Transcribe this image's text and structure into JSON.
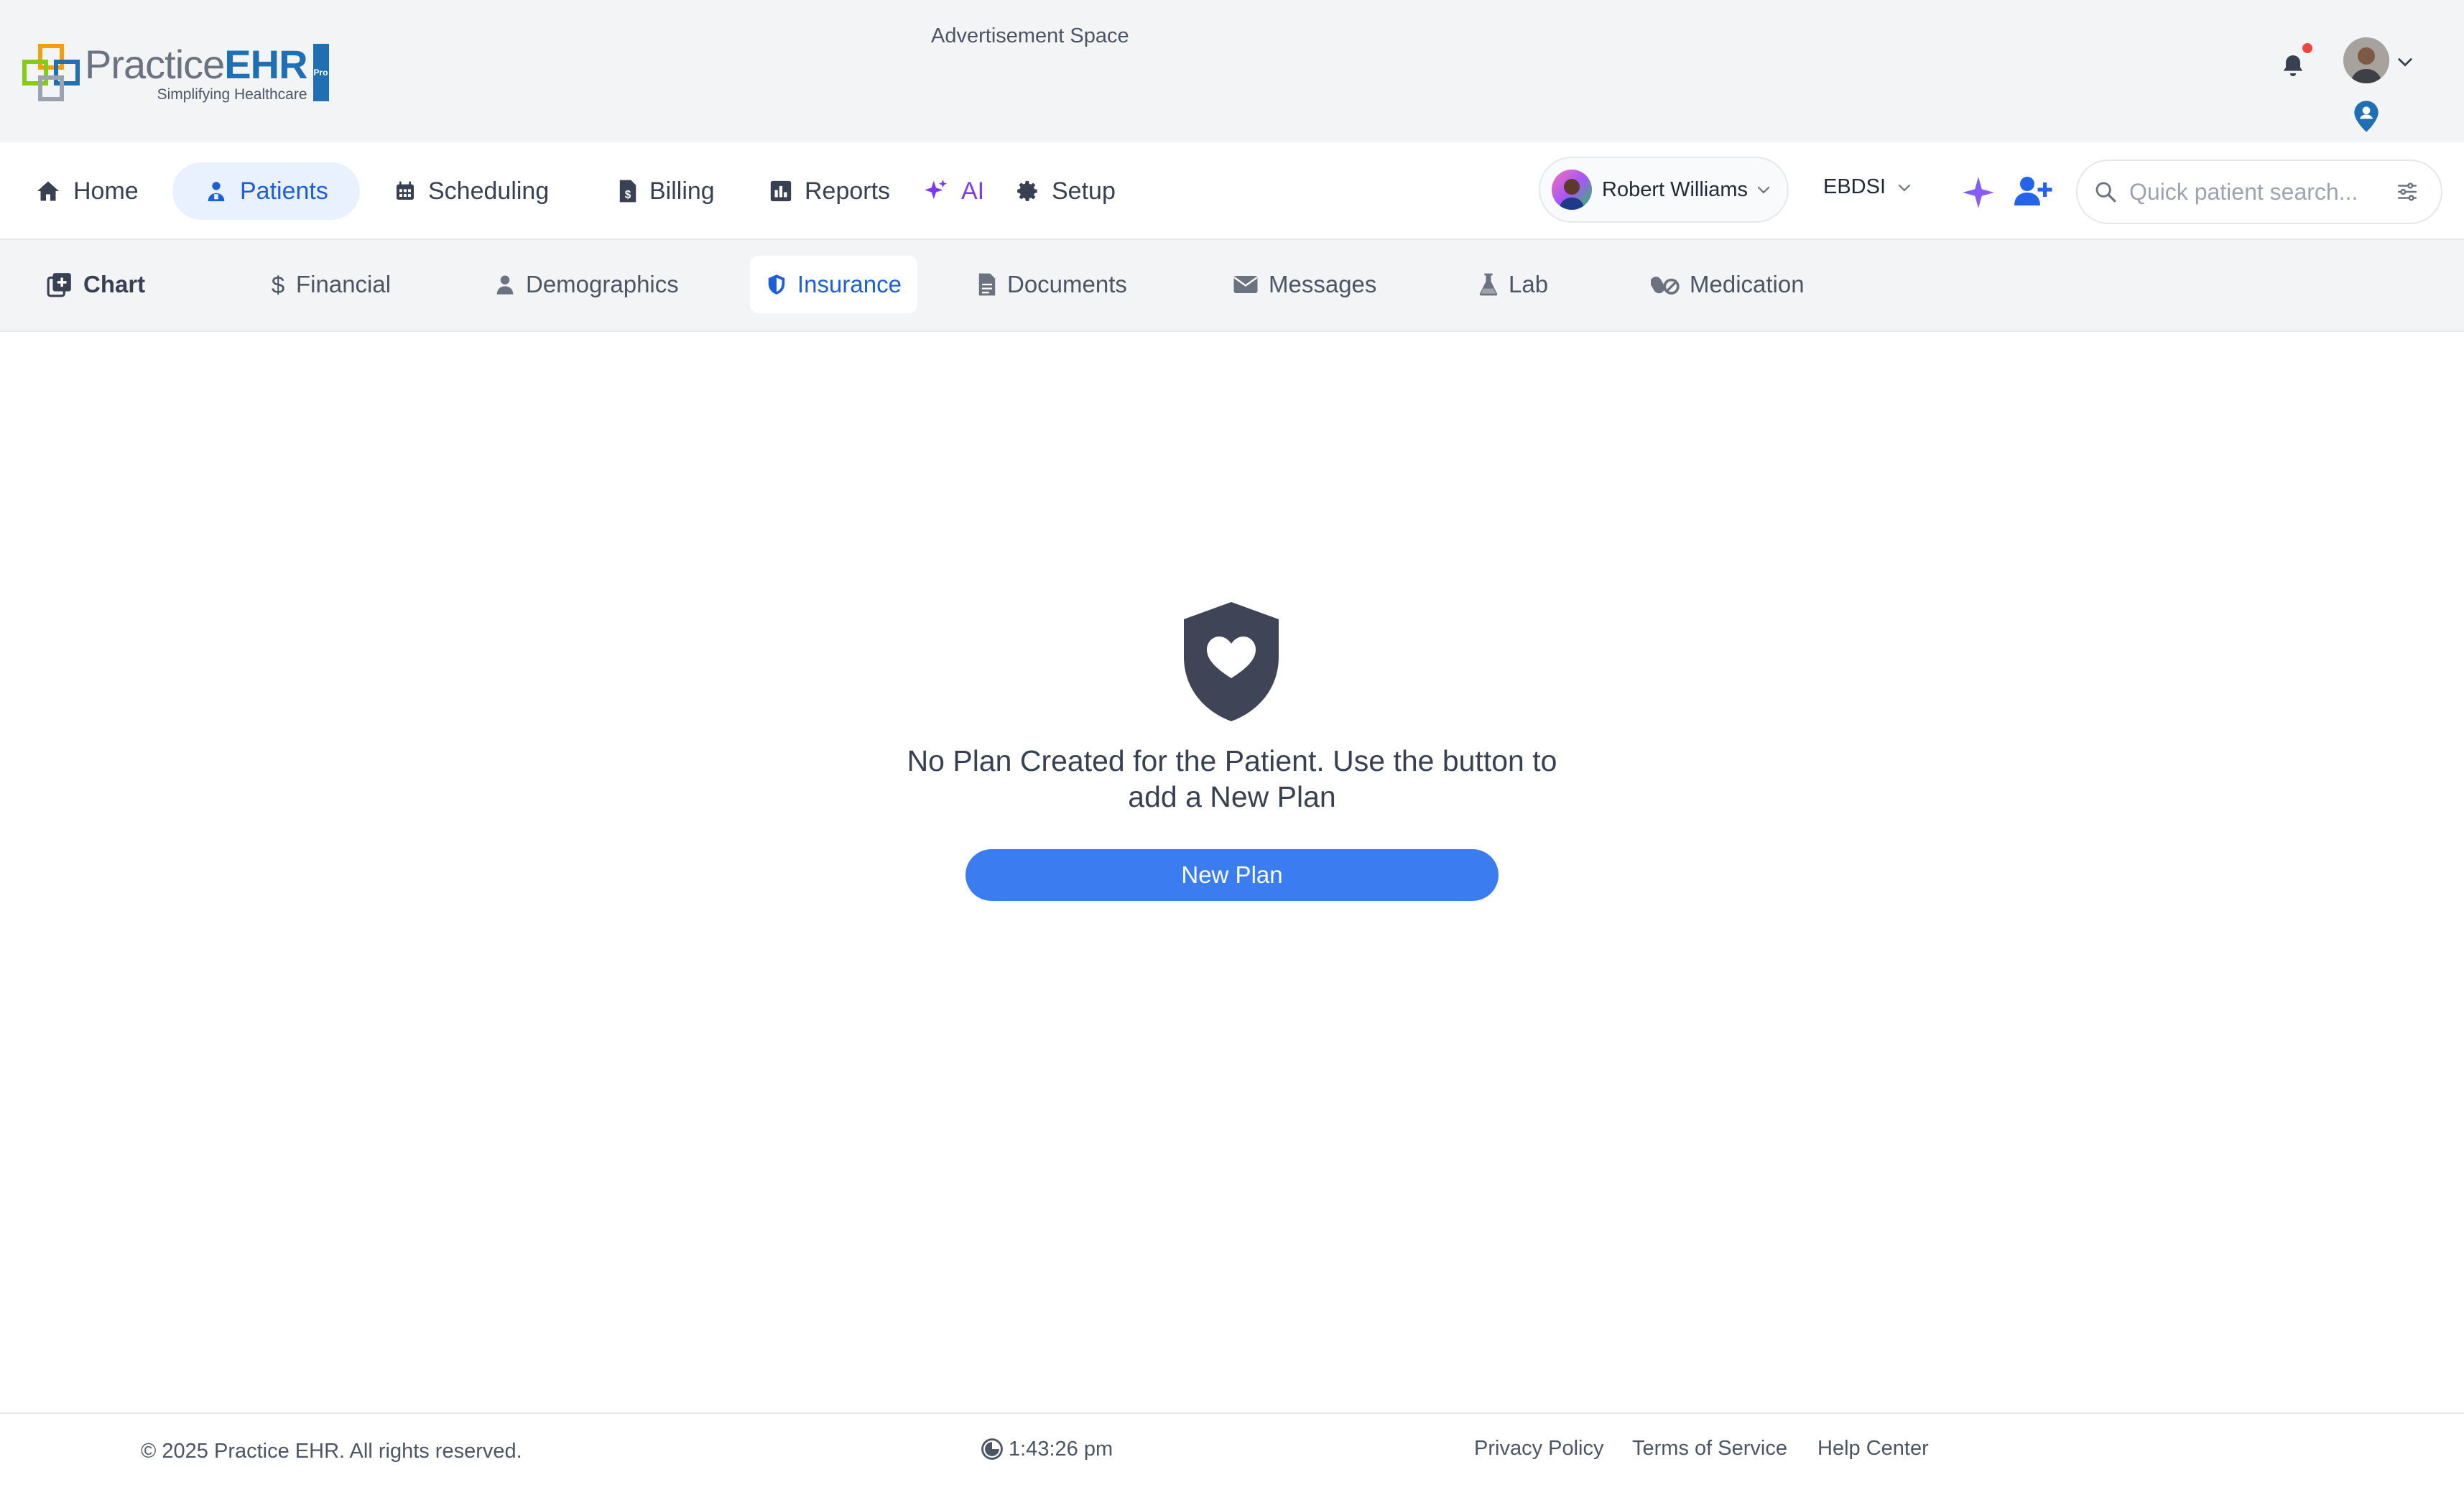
{
  "brand": {
    "name_part1": "Practice",
    "name_part2": "EHR",
    "tagline": "Simplifying Healthcare",
    "badge": "Pro"
  },
  "ad": {
    "label": "Advertisement Space"
  },
  "header": {
    "notification_dot_color": "#ef4444"
  },
  "nav": {
    "home": "Home",
    "patients": "Patients",
    "scheduling": "Scheduling",
    "billing": "Billing",
    "reports": "Reports",
    "ai": "AI",
    "setup": "Setup"
  },
  "patient_selector": {
    "name": "Robert Williams"
  },
  "facility": {
    "name": "EBDSI"
  },
  "search": {
    "placeholder": "Quick patient search..."
  },
  "tabs": {
    "chart": "Chart",
    "financial": "Financial",
    "demographics": "Demographics",
    "insurance": "Insurance",
    "documents": "Documents",
    "messages": "Messages",
    "lab": "Lab",
    "medication": "Medication",
    "active": "Insurance"
  },
  "empty_state": {
    "line1": "No Plan Created for the Patient. Use the button to",
    "line2": "add a New Plan",
    "button": "New Plan"
  },
  "footer": {
    "copyright": "© 2025 Practice EHR. All rights reserved.",
    "time": "1:43:26 pm",
    "privacy": "Privacy Policy",
    "terms": "Terms of Service",
    "help": "Help Center"
  },
  "colors": {
    "accent": "#3b7df0",
    "active_text": "#1e5ed6",
    "ai": "#7c3aed",
    "empty_icon": "#3f4456"
  }
}
